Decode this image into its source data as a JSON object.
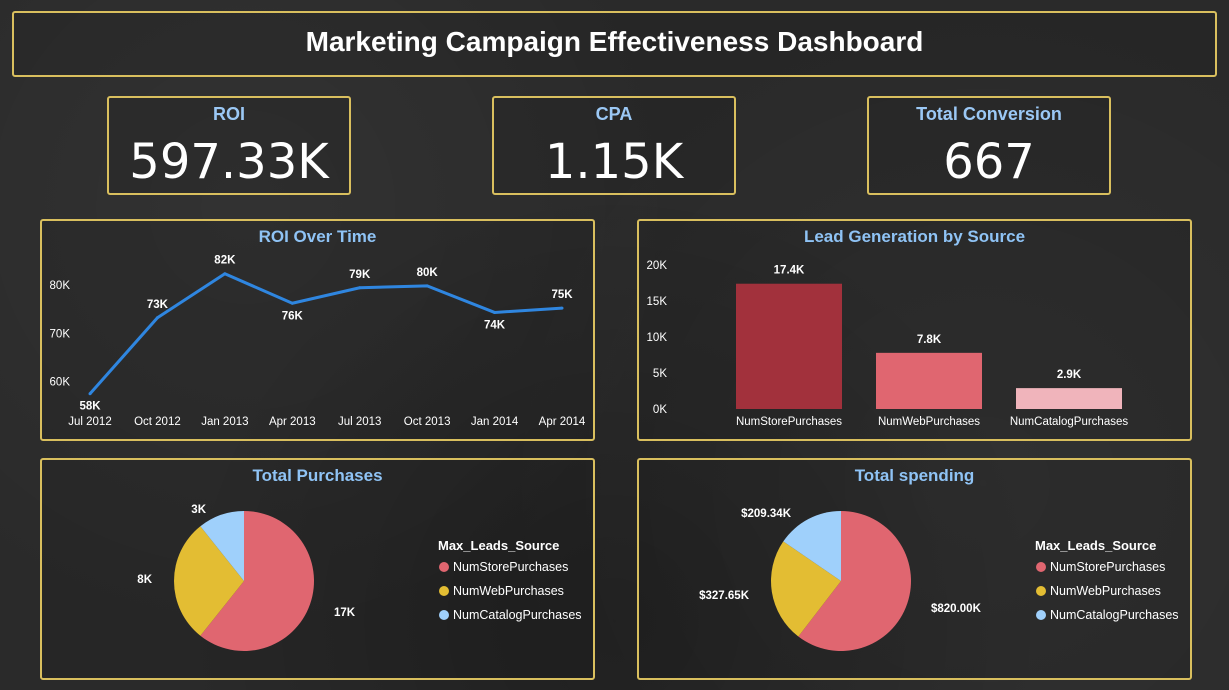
{
  "dashboard": {
    "title": "Marketing Campaign Effectiveness Dashboard"
  },
  "kpis": [
    {
      "label": "ROI",
      "value": "597.33K"
    },
    {
      "label": "CPA",
      "value": "1.15K"
    },
    {
      "label": "Total Conversion",
      "value": "667"
    }
  ],
  "colors": {
    "border": "#d9bf5e",
    "line": "#2f86e0",
    "store": "#e06670",
    "web": "#e3bd33",
    "catalog": "#9fd0fb",
    "bar_store": "#a2313c",
    "bar_web": "#e06670",
    "bar_catalog": "#f0b4bb"
  },
  "chart_data": [
    {
      "type": "line",
      "title": "ROI Over Time",
      "x": [
        "Jul 2012",
        "Oct 2012",
        "Jan 2013",
        "Apr 2013",
        "Jul 2013",
        "Oct 2013",
        "Jan 2014",
        "Apr 2014"
      ],
      "values": [
        57.5,
        73.2,
        82.3,
        76.2,
        79.4,
        79.8,
        74.3,
        75.2
      ],
      "data_labels": [
        "58K",
        "73K",
        "82K",
        "76K",
        "79K",
        "80K",
        "74K",
        "75K"
      ],
      "y_ticks": [
        "60K",
        "70K",
        "80K"
      ],
      "y_tick_values": [
        60,
        70,
        80
      ],
      "ylim": [
        56,
        87
      ]
    },
    {
      "type": "bar",
      "title": "Lead Generation by Source",
      "categories": [
        "NumStorePurchases",
        "NumWebPurchases",
        "NumCatalogPurchases"
      ],
      "values": [
        17.4,
        7.8,
        2.9
      ],
      "data_labels": [
        "17.4K",
        "7.8K",
        "2.9K"
      ],
      "y_ticks": [
        "0K",
        "5K",
        "10K",
        "15K",
        "20K"
      ],
      "y_tick_values": [
        0,
        5,
        10,
        15,
        20
      ],
      "ylim": [
        0,
        20
      ]
    },
    {
      "type": "pie",
      "title": "Total Purchases",
      "categories": [
        "NumStorePurchases",
        "NumWebPurchases",
        "NumCatalogPurchases"
      ],
      "values": [
        17,
        8,
        3
      ],
      "data_labels": [
        "17K",
        "8K",
        "3K"
      ],
      "legend_title": "Max_Leads_Source",
      "legend_position": "right"
    },
    {
      "type": "pie",
      "title": "Total spending",
      "categories": [
        "NumStorePurchases",
        "NumWebPurchases",
        "NumCatalogPurchases"
      ],
      "values": [
        820.0,
        327.65,
        209.34
      ],
      "data_labels": [
        "$820.00K",
        "$327.65K",
        "$209.34K"
      ],
      "legend_title": "Max_Leads_Source",
      "legend_position": "right"
    }
  ]
}
